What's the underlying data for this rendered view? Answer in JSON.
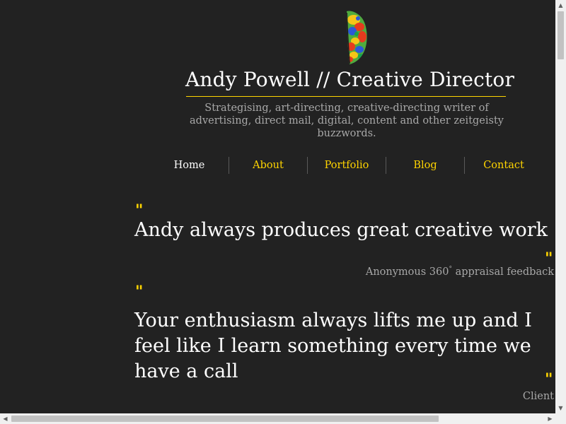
{
  "site": {
    "title": "Andy Powell // Creative Director",
    "tagline": "Strategising, art-directing, creative-directing writer of advertising, direct mail, digital, content and other zeitgeisty buzzwords.",
    "logo_icon": "brain-heatmap-icon"
  },
  "nav": {
    "items": [
      {
        "label": "Home",
        "active": true
      },
      {
        "label": "About",
        "active": false
      },
      {
        "label": "Portfolio",
        "active": false
      },
      {
        "label": "Blog",
        "active": false
      },
      {
        "label": "Contact",
        "active": false
      }
    ]
  },
  "quotes": [
    {
      "open_mark": "\"",
      "text": "Andy always produces great creative work",
      "close_mark": "\"",
      "attribution": "Anonymous 360",
      "attribution_sup": "°",
      "attribution_suffix": " appraisal feedback"
    },
    {
      "open_mark": "\"",
      "text": "Your enthusiasm always lifts me up and I feel like I learn something every time we have a call",
      "close_mark": "\"",
      "attribution": "Client"
    }
  ],
  "colors": {
    "background": "#222222",
    "accent": "#ffd400",
    "text": "#ffffff",
    "muted": "#a8a8a8"
  }
}
